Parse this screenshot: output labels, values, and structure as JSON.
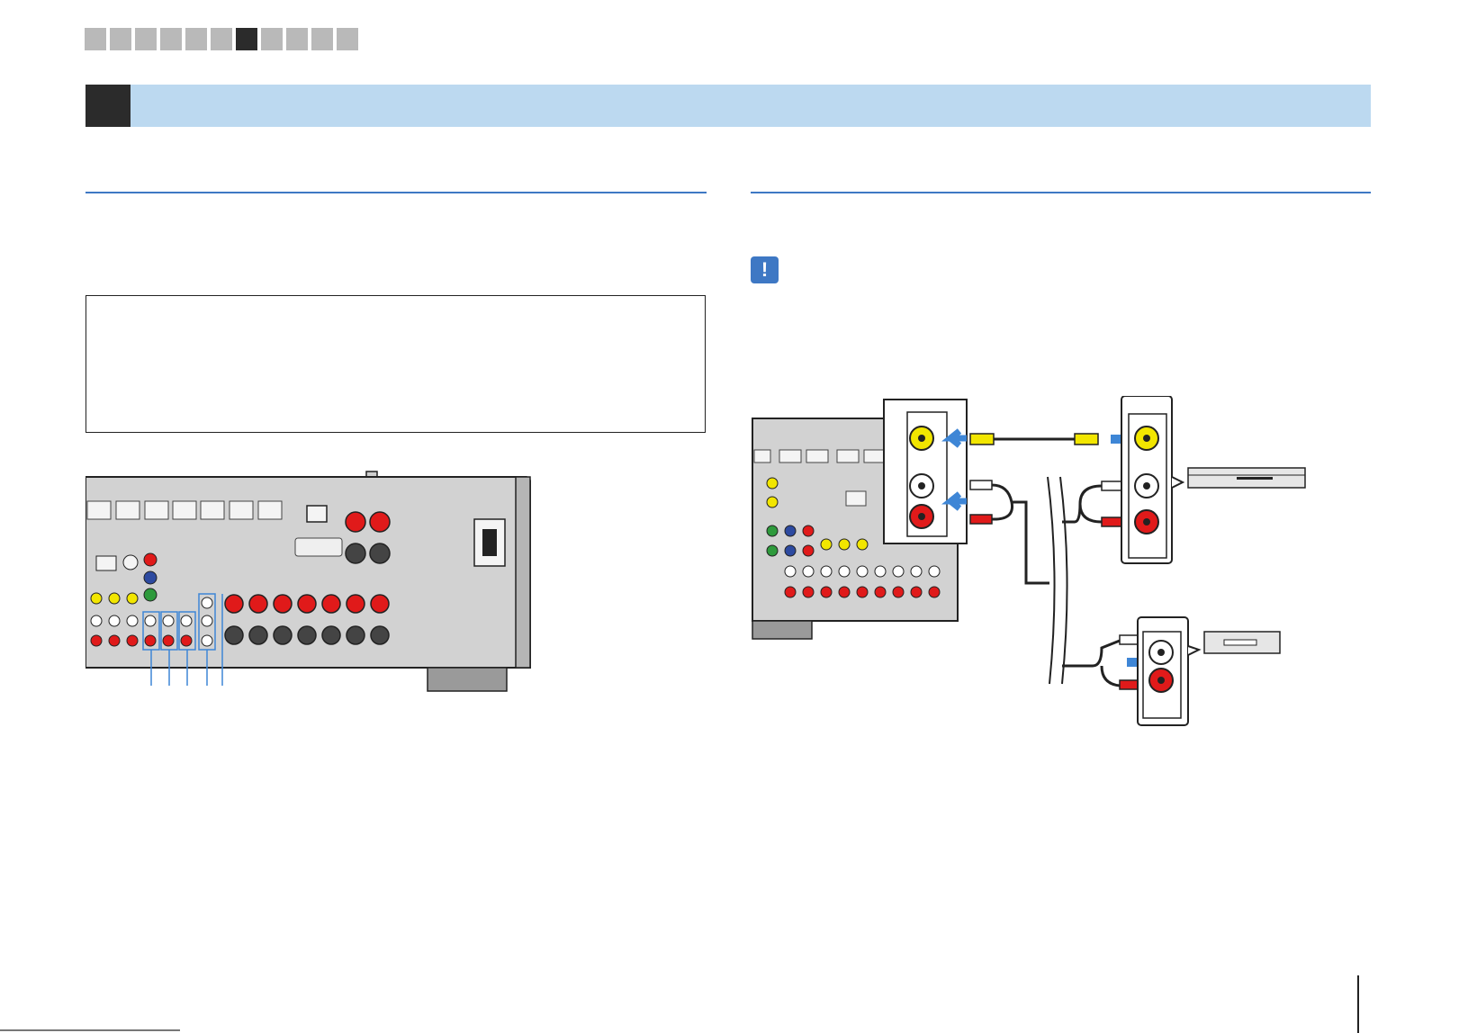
{
  "nav": {
    "tab_count": 11,
    "active_index": 6
  },
  "caution": {
    "icon": "!"
  },
  "colors": {
    "section_bar": "#bcd9f0",
    "accent_blue": "#3e78c4",
    "panel_gray": "#cfcfcf",
    "video_yellow": "#f2e600",
    "audio_red": "#e01a1a",
    "arrow_blue": "#3e86d6"
  }
}
